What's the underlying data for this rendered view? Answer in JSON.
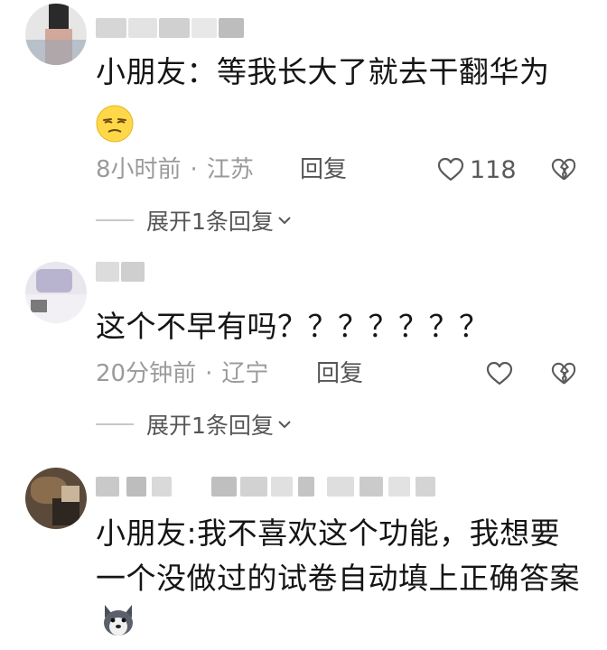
{
  "comments": [
    {
      "text": "小朋友：等我长大了就去干翻华为",
      "emoji": "smirk-emoji",
      "time": "8小时前",
      "location": "江苏",
      "reply_label": "回复",
      "like_count": "118",
      "expand_label": "展开1条回复"
    },
    {
      "text": "这个不早有吗？？？？？？？",
      "time": "20分钟前",
      "location": "辽宁",
      "reply_label": "回复",
      "like_count": "",
      "expand_label": "展开1条回复"
    },
    {
      "text": "小朋友:我不喜欢这个功能，我想要一个没做过的试卷自动填上正确答案",
      "emoji": "dog-face-emoji"
    }
  ],
  "separator": "·",
  "icons": {
    "like": "heart-outline-icon",
    "dislike": "broken-heart-icon",
    "expand": "chevron-down-icon"
  },
  "colors": {
    "text": "#151515",
    "meta": "#9a9a9a",
    "icon": "#5a5a5a"
  }
}
